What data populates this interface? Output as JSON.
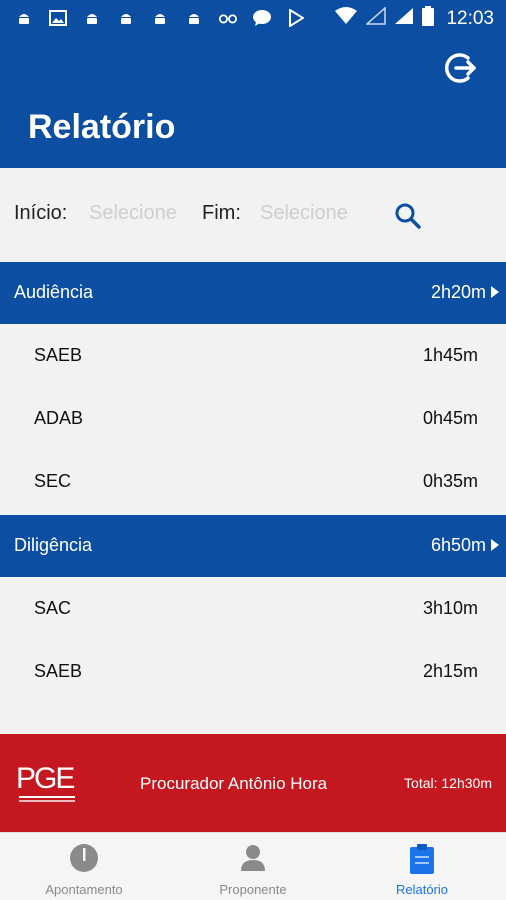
{
  "status_bar": {
    "time": "12:03",
    "icons": [
      "android-icon",
      "image-icon",
      "android-icon",
      "android-icon",
      "android-icon",
      "android-icon",
      "oo-icon",
      "chat-icon",
      "play-icon"
    ]
  },
  "header": {
    "title": "Relatório",
    "logout_icon": "logout-icon"
  },
  "filter": {
    "start_label": "Início:",
    "start_placeholder": "Selecione",
    "end_label": "Fim:",
    "end_placeholder": "Selecione",
    "search_icon": "search-icon"
  },
  "groups": [
    {
      "label": "Audiência",
      "total": "2h20m",
      "items": [
        {
          "label": "SAEB",
          "value": "1h45m"
        },
        {
          "label": "ADAB",
          "value": "0h45m"
        },
        {
          "label": "SEC",
          "value": "0h35m"
        }
      ]
    },
    {
      "label": "Diligência",
      "total": "6h50m",
      "items": [
        {
          "label": "SAC",
          "value": "3h10m"
        },
        {
          "label": "SAEB",
          "value": "2h15m"
        }
      ]
    }
  ],
  "footer": {
    "logo_text": "PGE",
    "procurador": "Procurador Antônio Hora",
    "total": "Total: 12h30m"
  },
  "bottom_nav": [
    {
      "label": "Apontamento",
      "icon": "pointer-icon",
      "active": false
    },
    {
      "label": "Proponente",
      "icon": "person-icon",
      "active": false
    },
    {
      "label": "Relatório",
      "icon": "clipboard-icon",
      "active": true
    }
  ],
  "colors": {
    "primary": "#0b4ea2",
    "footer": "#c41720",
    "active_nav": "#1a73e8"
  }
}
